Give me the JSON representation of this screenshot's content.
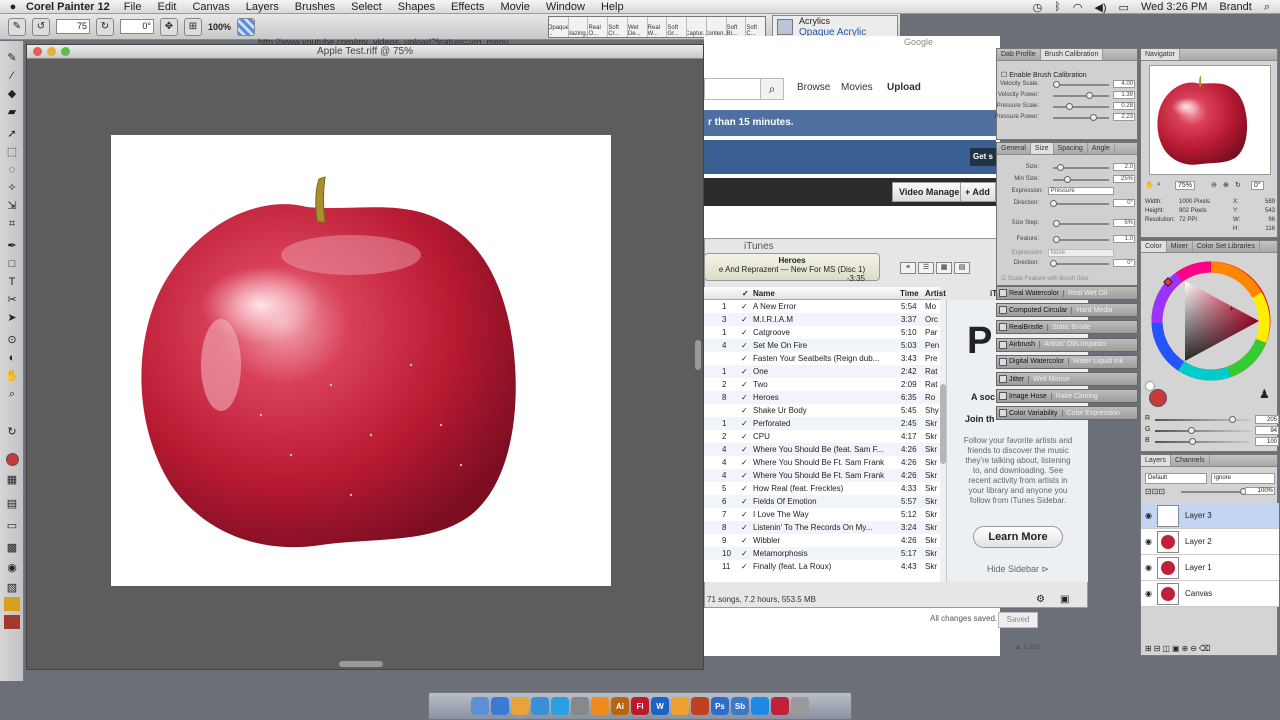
{
  "menubar": {
    "app_name": "Corel Painter 12",
    "items": [
      "File",
      "Edit",
      "Canvas",
      "Layers",
      "Brushes",
      "Select",
      "Shapes",
      "Effects",
      "Movie",
      "Window",
      "Help"
    ],
    "clock": "Wed 3:26 PM",
    "user": "Brandt"
  },
  "propbar": {
    "size_value": "75",
    "angle_value": "0°",
    "zoom_label": "100%"
  },
  "brush_strip": [
    "Opaque ...",
    "Glazing...",
    "Real O...",
    "Soft Cr...",
    "Wet De...",
    "Real W...",
    "Soft Gr...",
    "Captur...",
    "Conten...",
    "Soft Bl...",
    "Soft C..."
  ],
  "brush_category": {
    "category": "Acrylics",
    "variant": "Opaque Acrylic"
  },
  "document": {
    "title": "Apple Test.riff @ 75%"
  },
  "browser": {
    "url": "http://www.youtube.com/my_videos_upload?feature=vm_menu",
    "search_placeholder": "Google",
    "nav": [
      "Browse",
      "Movies",
      "Upload"
    ],
    "banner": "r than 15 minutes.",
    "banner_button": "Get s",
    "video_manager": "Video Manager",
    "add_label": "+ Add",
    "all_saved": "All changes saved.",
    "saved_button": "Saved",
    "less_link": "▲ Less"
  },
  "itunes": {
    "title": "iTunes",
    "now_playing_title": "Heroes",
    "now_playing_sub": "e And Reprazent — New For MS (Disc 1)",
    "time_remaining": "-3:35",
    "columns": {
      "name": "Name",
      "time": "Time",
      "artist": "Artist",
      "side_tag": "iT"
    },
    "tracks": [
      {
        "num": "1",
        "name": "A New Error",
        "time": "5:54",
        "artist": "Mo"
      },
      {
        "num": "3",
        "name": "M.I.R.I.A.M",
        "time": "3:37",
        "artist": "Orc"
      },
      {
        "num": "1",
        "name": "Catgroove",
        "time": "5:10",
        "artist": "Par"
      },
      {
        "num": "4",
        "name": "Set Me On Fire",
        "time": "5:03",
        "artist": "Pen"
      },
      {
        "num": "",
        "name": "Fasten Your Seatbelts (Reign dub...",
        "time": "3:43",
        "artist": "Pre"
      },
      {
        "num": "1",
        "name": "One",
        "time": "2:42",
        "artist": "Rat"
      },
      {
        "num": "2",
        "name": "Two",
        "time": "2:09",
        "artist": "Rat"
      },
      {
        "num": "8",
        "name": "Heroes",
        "time": "6:35",
        "artist": "Ro"
      },
      {
        "num": "",
        "name": "Shake Ur Body",
        "time": "5:45",
        "artist": "Shy"
      },
      {
        "num": "1",
        "name": "Perforated",
        "time": "2:45",
        "artist": "Skr"
      },
      {
        "num": "2",
        "name": "CPU",
        "time": "4:17",
        "artist": "Skr"
      },
      {
        "num": "4",
        "name": "Where You Should Be (feat. Sam F...",
        "time": "4:26",
        "artist": "Skr"
      },
      {
        "num": "4",
        "name": "Where You Should Be Ft. Sam Frank",
        "time": "4:26",
        "artist": "Skr"
      },
      {
        "num": "4",
        "name": "Where You Should Be Ft. Sam Frank",
        "time": "4:26",
        "artist": "Skr"
      },
      {
        "num": "5",
        "name": "How Real (feat. Freckles)",
        "time": "4:33",
        "artist": "Skr"
      },
      {
        "num": "6",
        "name": "Fields Of Emotion",
        "time": "5:57",
        "artist": "Skr"
      },
      {
        "num": "7",
        "name": "I Love The Way",
        "time": "5:12",
        "artist": "Skr"
      },
      {
        "num": "8",
        "name": "Listenin' To The Records On My...",
        "time": "3:24",
        "artist": "Skr"
      },
      {
        "num": "9",
        "name": "Wibbler",
        "time": "4:26",
        "artist": "Skr"
      },
      {
        "num": "10",
        "name": "Metamorphosis",
        "time": "5:17",
        "artist": "Skr"
      },
      {
        "num": "11",
        "name": "Finally (feat. La Roux)",
        "time": "4:43",
        "artist": "Skr"
      }
    ],
    "status": "71 songs, 7.2 hours, 553.5 MB",
    "sidebar": {
      "big_letter": "P",
      "line1": "A soc",
      "line2": "Join th",
      "description": "Follow your favorite artists and friends to discover the music they're talking about, listening to, and downloading. See recent activity from artists in your library and anyone you follow from iTunes Sidebar.",
      "learn_more": "Learn More",
      "hide_sidebar": "Hide Sidebar"
    }
  },
  "calibration": {
    "tabs": [
      "Dab Profile",
      "Brush Calibration"
    ],
    "enable_label": "Enable Brush Calibration",
    "rows": [
      {
        "label": "Velocity Scale:",
        "value": "4.00",
        "pos": 0.05
      },
      {
        "label": "Velocity Power:",
        "value": "1.39",
        "pos": 0.65
      },
      {
        "label": "Pressure Scale:",
        "value": "0.28",
        "pos": 0.28
      },
      {
        "label": "Pressure Power:",
        "value": "2.23",
        "pos": 0.72
      }
    ]
  },
  "general_panel": {
    "tabs": [
      "General",
      "Size",
      "Spacing",
      "Angle"
    ],
    "rows": [
      {
        "label": "Size:",
        "value": "2.0",
        "pos": 0.12
      },
      {
        "label": "Min Size:",
        "value": "25%",
        "pos": 0.25
      },
      {
        "label": "Direction:",
        "value": "0°",
        "pos": 0.0
      },
      {
        "label": "Size Step:",
        "value": "5%",
        "pos": 0.05
      },
      {
        "label": "Feature:",
        "value": "1.0",
        "pos": 0.05
      },
      {
        "label": "Direction:",
        "value": "0°",
        "pos": 0.0
      }
    ],
    "expression_label": "Expression:",
    "expression_value": "Pressure",
    "expression_label2": "Expression:",
    "expression_value2": "None",
    "scale_feature": "Scale Feature with Brush Size"
  },
  "panel_bars": [
    {
      "a": "Real Watercolor",
      "b": "Real Wet Oil"
    },
    {
      "a": "Computed Circular",
      "b": "Hard Media"
    },
    {
      "a": "RealBristle",
      "b": "Static Bristle"
    },
    {
      "a": "Airbrush",
      "b": "Artists' Oils   Impasto"
    },
    {
      "a": "Digital Watercolor",
      "b": "Water   Liquid Ink"
    },
    {
      "a": "Jitter",
      "b": "Well   Mouse"
    },
    {
      "a": "Image Hose",
      "b": "Rake   Cloning"
    },
    {
      "a": "Color Variability",
      "b": "Color Expression"
    }
  ],
  "navigator": {
    "title": "Navigator",
    "zoom": "75%",
    "angle": "0°",
    "info": [
      {
        "label": "Width:",
        "value": "1000 Pixels",
        "xlab": "X:",
        "xval": "589"
      },
      {
        "label": "Height:",
        "value": "902 Pixels",
        "xlab": "Y:",
        "xval": "543"
      },
      {
        "label": "Resolution:",
        "value": "72 PPI",
        "xlab": "W:",
        "xval": "96"
      },
      {
        "label": "",
        "value": "",
        "xlab": "H:",
        "xval": "116"
      }
    ]
  },
  "color_panel": {
    "tabs": [
      "Color",
      "Mixer",
      "Color Set Libraries"
    ],
    "current_color": "#c8393b",
    "rgb": [
      {
        "label": "R",
        "value": "205",
        "pos": 0.8
      },
      {
        "label": "G",
        "value": "94",
        "pos": 0.37
      },
      {
        "label": "B",
        "value": "100",
        "pos": 0.39
      }
    ]
  },
  "layers_panel": {
    "tabs": [
      "Layers",
      "Channels"
    ],
    "composite": "Default",
    "method": "Ignore",
    "opacity": "100%",
    "layers": [
      {
        "name": "Layer 3",
        "selected": true
      },
      {
        "name": "Layer 2",
        "selected": false
      },
      {
        "name": "Layer 1",
        "selected": false
      },
      {
        "name": "Canvas",
        "selected": false
      }
    ]
  },
  "dock": {
    "apps": [
      "Finder",
      "Safari",
      "Chrome",
      "App Store",
      "iTunes",
      "Grab",
      "VLC",
      "Ai",
      "Fl",
      "W",
      "Pages",
      "Brush",
      "Ps",
      "Sb",
      "Browser",
      "Painter",
      "Trash"
    ]
  },
  "colors": {
    "apple_red": "#c0203a",
    "selection_blue": "#c3d5f3",
    "banner_blue": "#4e6fa0"
  }
}
